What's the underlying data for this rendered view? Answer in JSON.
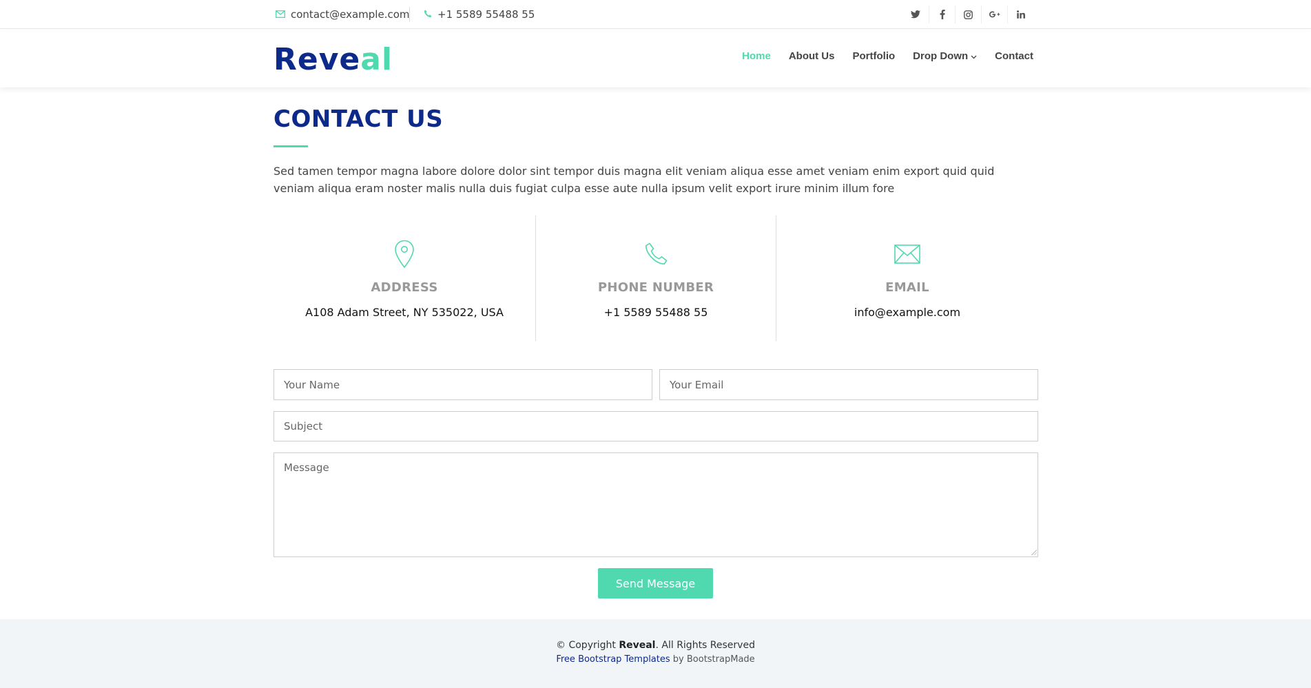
{
  "topbar": {
    "email": "contact@example.com",
    "phone": "+1 5589 55488 55",
    "socials": [
      {
        "icon": "twitter-icon"
      },
      {
        "icon": "facebook-icon"
      },
      {
        "icon": "instagram-icon"
      },
      {
        "icon": "google-plus-icon"
      },
      {
        "icon": "linkedin-icon"
      }
    ]
  },
  "header": {
    "logo_main": "Reve",
    "logo_accent": "al",
    "nav": [
      {
        "label": "Home",
        "active": true
      },
      {
        "label": "About Us"
      },
      {
        "label": "Portfolio"
      },
      {
        "label": "Drop Down",
        "dropdown": true
      },
      {
        "label": "Contact"
      }
    ]
  },
  "contact": {
    "title": "CONTACT US",
    "intro": "Sed tamen tempor magna labore dolore dolor sint tempor duis magna elit veniam aliqua esse amet veniam enim export quid quid veniam aliqua eram noster malis nulla duis fugiat culpa esse aute nulla ipsum velit export irure minim illum fore",
    "info": [
      {
        "icon": "map-pin-icon",
        "heading": "Address",
        "value": "A108 Adam Street, NY 535022, USA"
      },
      {
        "icon": "phone-icon",
        "heading": "Phone Number",
        "value": "+1 5589 55488 55"
      },
      {
        "icon": "envelope-icon",
        "heading": "Email",
        "value": "info@example.com"
      }
    ]
  },
  "form": {
    "name_placeholder": "Your Name",
    "email_placeholder": "Your Email",
    "subject_placeholder": "Subject",
    "message_placeholder": "Message",
    "submit_label": "Send Message"
  },
  "footer": {
    "copyright_prefix": "© Copyright ",
    "copyright_brand": "Reveal",
    "copyright_suffix": ". All Rights Reserved",
    "credits_link": "Free Bootstrap Templates",
    "credits_suffix": " by BootstrapMade"
  },
  "colors": {
    "brand": "#0d2a8a",
    "accent": "#50d8af"
  }
}
